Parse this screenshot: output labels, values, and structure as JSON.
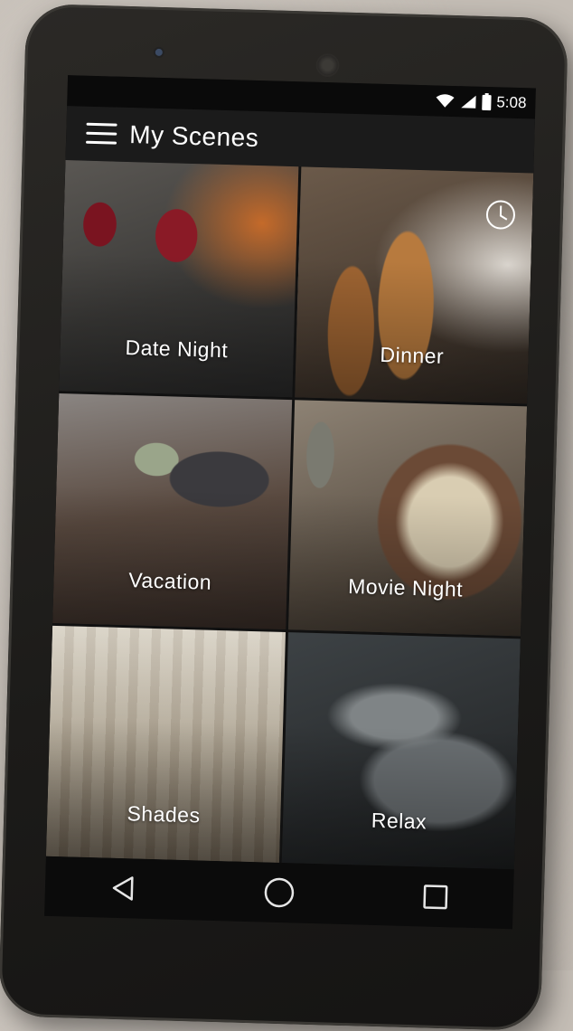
{
  "status": {
    "time": "5:08"
  },
  "appbar": {
    "title": "My Scenes"
  },
  "scenes": [
    {
      "label": "Date Night"
    },
    {
      "label": "Dinner",
      "scheduled": true
    },
    {
      "label": "Vacation"
    },
    {
      "label": "Movie Night"
    },
    {
      "label": "Shades"
    },
    {
      "label": "Relax"
    }
  ],
  "navbar": {
    "icons": [
      "back-icon",
      "home-icon",
      "recents-icon"
    ]
  }
}
